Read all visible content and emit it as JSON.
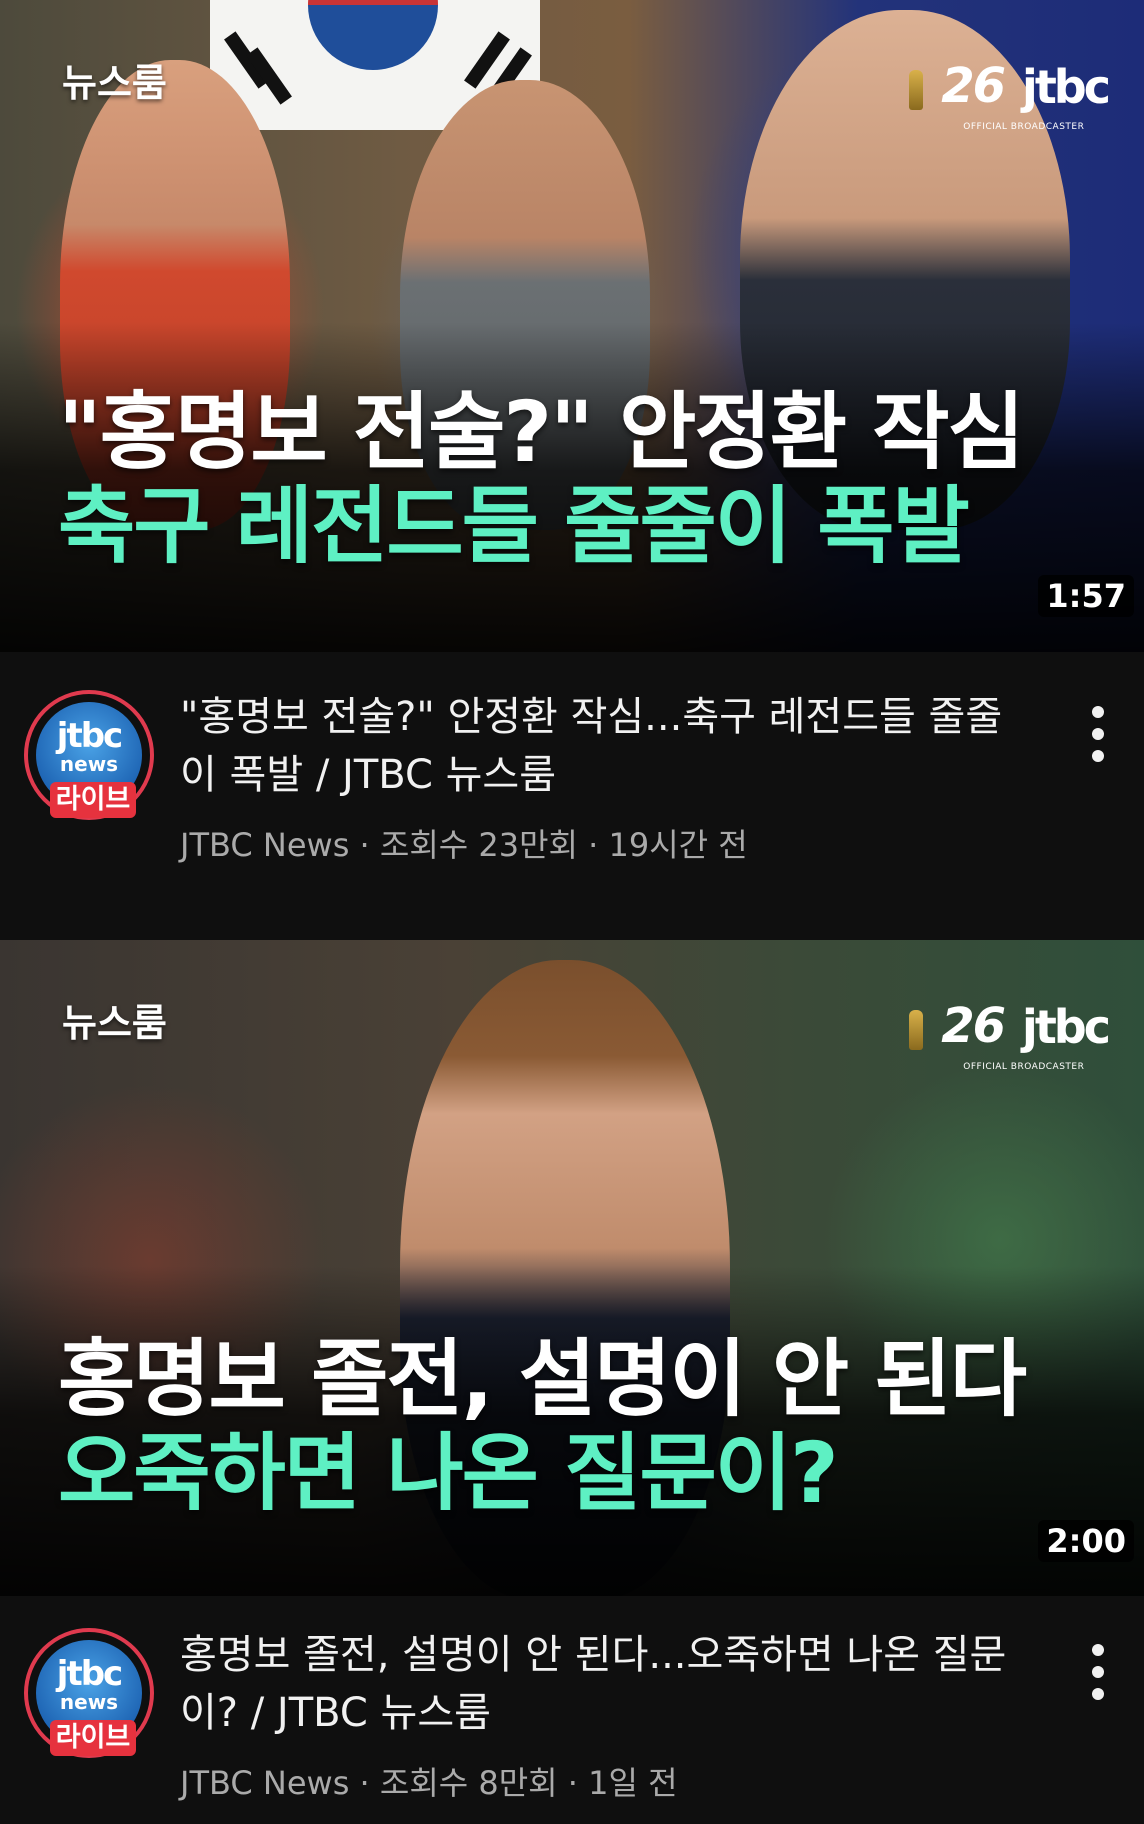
{
  "videos": [
    {
      "tag": "뉴스룸",
      "brand": {
        "number": "26",
        "logo": "jtbc",
        "sub": "OFFICIAL BROADCASTER"
      },
      "headline_line1": "\"홍명보 전술?\" 안정환 작심",
      "headline_line2": "축구 레전드들 줄줄이 폭발",
      "duration": "1:57",
      "title": "\"홍명보 전술?\" 안정환 작심...축구 레전드들 줄줄이 폭발 / JTBC 뉴스룸",
      "channel": "JTBC News",
      "views": "조회수 23만회",
      "age": "19시간 전",
      "separator": "·",
      "avatar": {
        "logo": "jtbc",
        "news": "news",
        "live": "라이브"
      }
    },
    {
      "tag": "뉴스룸",
      "brand": {
        "number": "26",
        "logo": "jtbc",
        "sub": "OFFICIAL BROADCASTER"
      },
      "headline_line1": "홍명보 졸전, 설명이 안 된다",
      "headline_line2": "오죽하면 나온 질문이?",
      "duration": "2:00",
      "title": "홍명보 졸전, 설명이 안 된다...오죽하면 나온 질문이? / JTBC 뉴스룸",
      "channel": "JTBC News",
      "views": "조회수 8만회",
      "age": "1일 전",
      "separator": "·",
      "avatar": {
        "logo": "jtbc",
        "news": "news",
        "live": "라이브"
      }
    }
  ],
  "icons": {
    "more": "more-vert-icon",
    "trophy": "world-cup-trophy-icon"
  },
  "colors": {
    "background": "#0f0f0f",
    "headline_accent": "#5ef0c3",
    "avatar_ring": "#e03a4e",
    "secondary_text": "#aaaaaa"
  }
}
